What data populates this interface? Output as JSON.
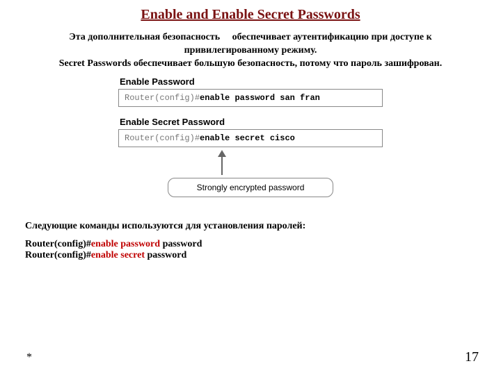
{
  "title": "Enable and Enable Secret Passwords",
  "intro_lines": [
    "Эта дополнительная безопасность     обеспечивает аутентификацию при доступе к привилегированному режиму.",
    "Secret Passwords обеспечивает большую безопасность, потому что пароль зашифрован."
  ],
  "diagram": {
    "enable_password_label": "Enable Password",
    "enable_password_prompt": "Router(config)#",
    "enable_password_cmd": "enable password san fran",
    "enable_secret_label": "Enable Secret Password",
    "enable_secret_prompt": "Router(config)#",
    "enable_secret_cmd": "enable secret cisco",
    "callout": "Strongly encrypted password"
  },
  "next_commands_label": "Следующие команды используются для  установления паролей:",
  "cmd1_prefix": "Router(config)#",
  "cmd1_red": "enable password ",
  "cmd1_suffix": " password",
  "cmd2_prefix": "Router(config)#",
  "cmd2_red": "enable secret ",
  "cmd2_suffix": "password",
  "footer_star": "*",
  "page_number": "17"
}
